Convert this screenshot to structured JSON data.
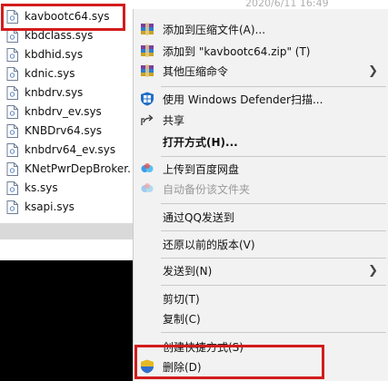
{
  "top_fragment": "2020/6/11 16:49",
  "files": [
    {
      "name": "kavbootc64.sys",
      "selected": true
    },
    {
      "name": "kbdclass.sys"
    },
    {
      "name": "kbdhid.sys"
    },
    {
      "name": "kdnic.sys"
    },
    {
      "name": "knbdrv.sys"
    },
    {
      "name": "knbdrv_ev.sys"
    },
    {
      "name": "KNBDrv64.sys"
    },
    {
      "name": "knbdrv64_ev.sys"
    },
    {
      "name": "KNetPwrDepBroker."
    },
    {
      "name": "ks.sys"
    },
    {
      "name": "ksapi.sys"
    }
  ],
  "menu": {
    "add_archive": "添加到压缩文件(A)...",
    "add_zip": "添加到 \"kavbootc64.zip\" (T)",
    "other_compress": "其他压缩命令",
    "defender": "使用 Windows Defender扫描...",
    "share": "共享",
    "open_with": "打开方式(H)...",
    "upload_baidu": "上传到百度网盘",
    "auto_backup": "自动备份该文件夹",
    "send_qq": "通过QQ发送到",
    "restore": "还原以前的版本(V)",
    "send_to": "发送到(N)",
    "cut": "剪切(T)",
    "copy": "复制(C)",
    "shortcut": "创建快捷方式(S)",
    "delete": "删除(D)"
  },
  "colors": {
    "highlight_red": "#d31c1c",
    "menu_bg": "#f2f2f2",
    "disabled": "#9a9a9a"
  }
}
